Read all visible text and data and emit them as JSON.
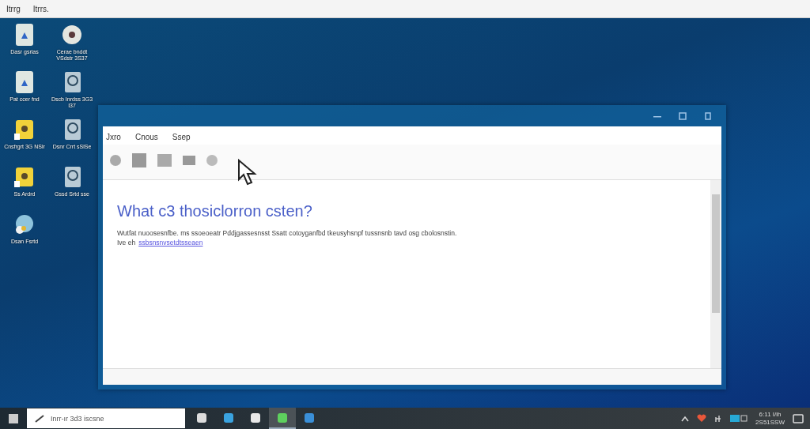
{
  "top_menu": [
    "Itrrg",
    "Itrrs."
  ],
  "desktop_icons": [
    {
      "label": "Dasr gsrlas",
      "kind": "document"
    },
    {
      "label": "Cerae bnddt VSdstr 3S37",
      "kind": "disc"
    },
    {
      "label": "Pat ccer fnd",
      "kind": "document"
    },
    {
      "label": "Dscb Inrdss 3G3 I37",
      "kind": "drive"
    },
    {
      "label": "Cnsfrgrt 3G NSlr",
      "kind": "folder"
    },
    {
      "label": "Dsnr Crrt sSlSe",
      "kind": "drive"
    },
    {
      "label": "Ss Ardrd",
      "kind": "folder"
    },
    {
      "label": "Gssd Srtd sse",
      "kind": "drive"
    },
    {
      "label": "Dsan Fsrtd",
      "kind": "globe"
    }
  ],
  "window": {
    "menu": [
      "Jxro",
      "Cnous",
      "Ssep"
    ],
    "heading": "What c3 thosiclorron csten?",
    "paragraph": "Wutfat nuoosesnfbe. ms ssoeoeatr Pddjgassesnsst Ssatt cotoyganfbd tkeusyhsnpf tussnsnb tavd osg cbolosnstin.",
    "link_prefix": "Ive eh",
    "link": "ssbsnsnvsetdtsseaen"
  },
  "taskbar": {
    "search_placeholder": "Inrr-ır 3d3 iscsne",
    "apps": [
      {
        "selected": false
      },
      {
        "selected": false
      },
      {
        "selected": false
      },
      {
        "selected": true
      },
      {
        "selected": false
      }
    ],
    "clock_time": "6:11 I/ih",
    "clock_date": "2S51SSW"
  }
}
